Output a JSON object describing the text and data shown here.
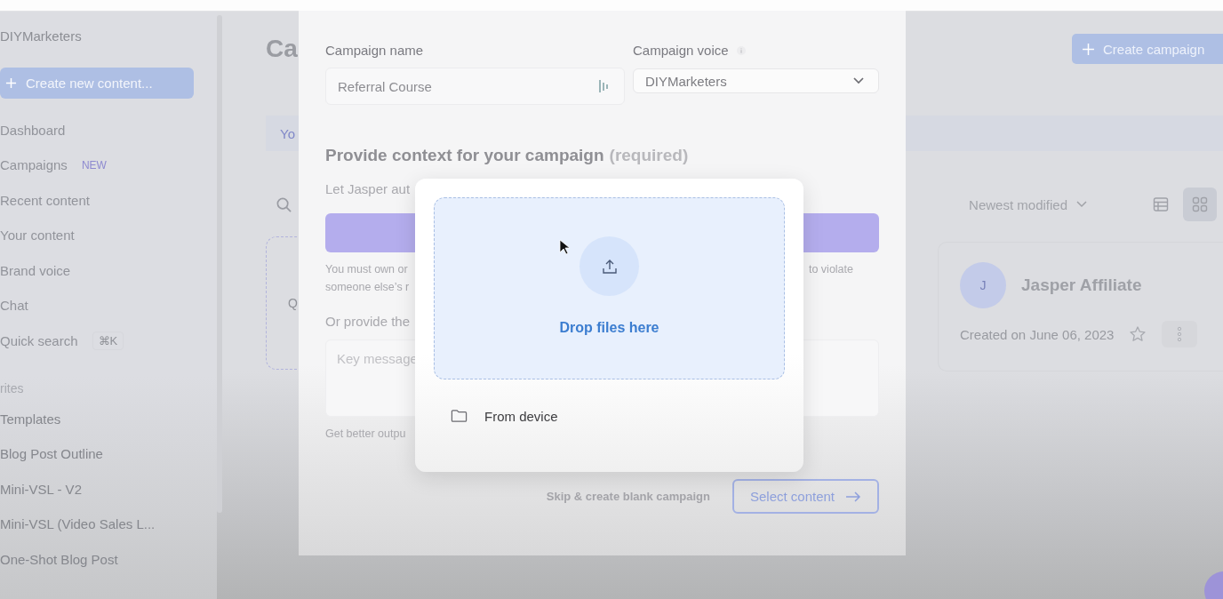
{
  "sidebar": {
    "workspace": "DIYMarketers",
    "create_button": "Create new content...",
    "nav": [
      {
        "label": "Dashboard"
      },
      {
        "label": "Campaigns",
        "badge": "NEW"
      },
      {
        "label": "Recent content"
      },
      {
        "label": "Your content"
      },
      {
        "label": "Brand voice"
      },
      {
        "label": "Chat"
      },
      {
        "label": "Quick search",
        "shortcut": "⌘K"
      }
    ],
    "section_title": "rites",
    "favorites": [
      "Templates",
      "Blog Post Outline",
      "Mini-VSL - V2",
      "Mini-VSL (Video Sales L...",
      "One-Shot Blog Post"
    ]
  },
  "page": {
    "title": "Ca",
    "tab": "Yo",
    "create_button": "Create campaign",
    "sort": "Newest modified",
    "views": [
      {
        "kind": "list",
        "selected": false
      },
      {
        "kind": "grid",
        "selected": true
      }
    ],
    "partial_card_text": "Q",
    "card": {
      "avatar": "J",
      "name": "Jasper Affiliate",
      "created": "Created on June 06, 2023"
    }
  },
  "modal": {
    "name_label": "Campaign name",
    "name_value": "Referral Course",
    "voice_label": "Campaign voice",
    "voice_value": "DIYMarketers",
    "heading": "Provide context for your campaign",
    "heading_note": "(required)",
    "intro": "Let Jasper aut",
    "notice_left": [
      "You must own or",
      "someone else’s r"
    ],
    "notice_right": "to violate",
    "alt_label": "Or provide the",
    "message_placeholder": "Key message",
    "hint": "Get better outpu",
    "skip_link": "Skip & create blank campaign",
    "select_button": "Select content"
  },
  "file_popup": {
    "drop_text": "Drop files here",
    "source": "From device"
  }
}
